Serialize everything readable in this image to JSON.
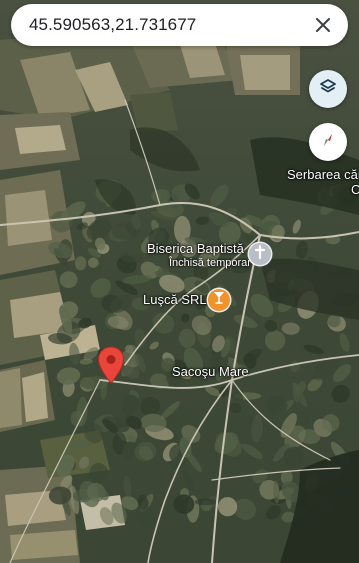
{
  "search": {
    "query": "45.590563,21.731677"
  },
  "map": {
    "type": "satellite",
    "labels": {
      "offscreen_place": "Serbarea căn",
      "offscreen_place_fragment": "C",
      "church_name": "Biserica Baptistă",
      "church_status": "Închisă temporar",
      "business_name": "Luşcă SRL",
      "village_name": "Sacoşu Mare"
    }
  },
  "icons": {
    "close": "close-icon",
    "layers": "layers-icon",
    "compass": "compass-icon",
    "church": "church-cross-icon",
    "bar": "cocktail-glass-icon",
    "pin": "map-pin-icon"
  },
  "colors": {
    "church_poi": "#b9bec6",
    "bar_poi": "#f0932b",
    "pin": "#e8453c",
    "layers_bg": "#e3eef5",
    "compass_north": "#e8453c"
  }
}
